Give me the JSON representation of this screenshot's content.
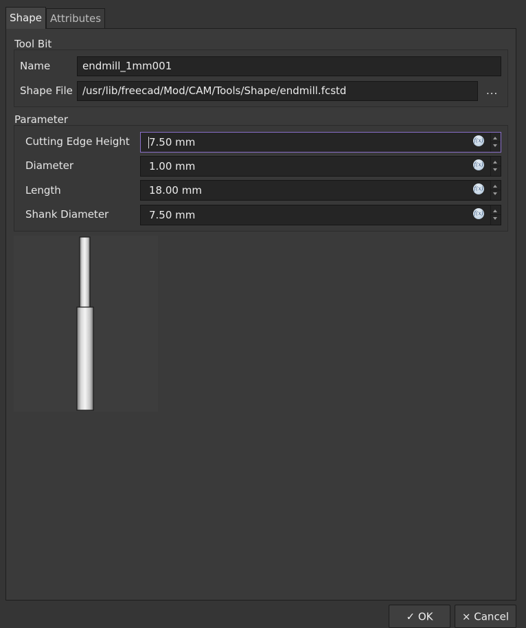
{
  "tabs": [
    {
      "label": "Shape",
      "active": true
    },
    {
      "label": "Attributes",
      "active": false
    }
  ],
  "tool_bit": {
    "title": "Tool Bit",
    "name_label": "Name",
    "name_value": "endmill_1mm001",
    "shape_file_label": "Shape File",
    "shape_file_value": "/usr/lib/freecad/Mod/CAM/Tools/Shape/endmill.fcstd",
    "browse_label": "..."
  },
  "parameter": {
    "title": "Parameter",
    "rows": [
      {
        "label": "Cutting  Edge  Height",
        "value": "7.50 mm"
      },
      {
        "label": "Diameter",
        "value": "1.00 mm"
      },
      {
        "label": "Length",
        "value": "18.00 mm"
      },
      {
        "label": "Shank  Diameter",
        "value": "7.50 mm"
      }
    ],
    "expression_icon_text": "f(x)"
  },
  "icons": {
    "ok": "check-icon",
    "cancel": "x-icon",
    "expression": "fx-icon"
  },
  "buttons": {
    "ok_icon": "✓",
    "ok_label": "OK",
    "cancel_icon": "×",
    "cancel_label": "Cancel"
  },
  "colors": {
    "focus_border": "#8a6fc9",
    "background": "#353535"
  }
}
